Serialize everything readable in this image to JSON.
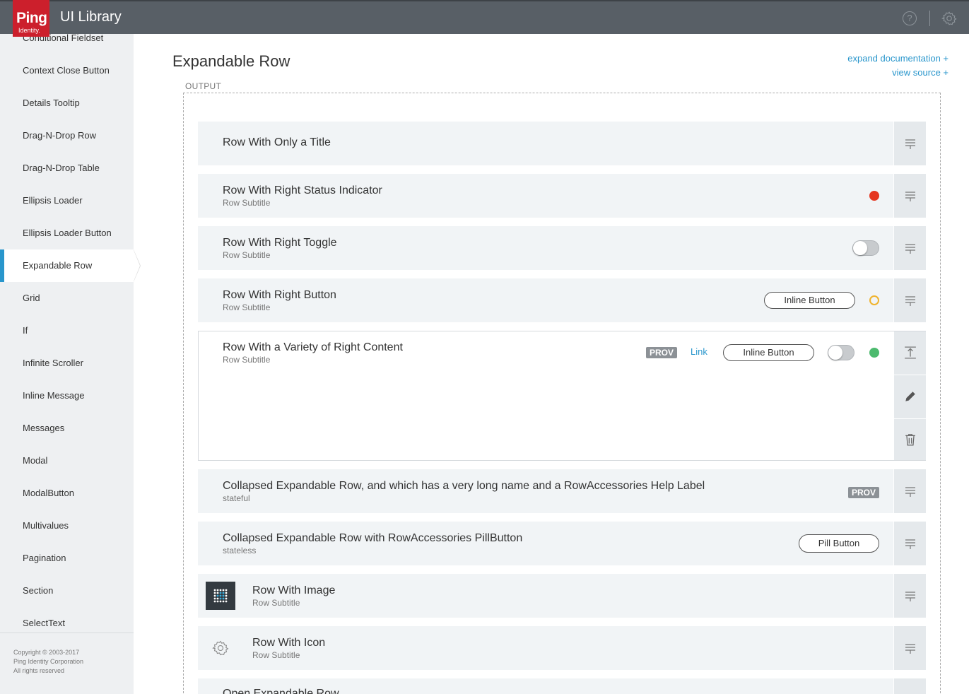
{
  "header": {
    "logo_main": "Ping",
    "logo_sub": "Identity.",
    "app_title": "UI Library",
    "help_glyph": "?",
    "icons": [
      "help-icon",
      "gear-icon"
    ]
  },
  "sidebar": {
    "items": [
      {
        "label": "Conditional Fieldset",
        "active": false
      },
      {
        "label": "Context Close Button",
        "active": false
      },
      {
        "label": "Details Tooltip",
        "active": false
      },
      {
        "label": "Drag-N-Drop Row",
        "active": false
      },
      {
        "label": "Drag-N-Drop Table",
        "active": false
      },
      {
        "label": "Ellipsis Loader",
        "active": false
      },
      {
        "label": "Ellipsis Loader Button",
        "active": false
      },
      {
        "label": "Expandable Row",
        "active": true
      },
      {
        "label": "Grid",
        "active": false
      },
      {
        "label": "If",
        "active": false
      },
      {
        "label": "Infinite Scroller",
        "active": false
      },
      {
        "label": "Inline Message",
        "active": false
      },
      {
        "label": "Messages",
        "active": false
      },
      {
        "label": "Modal",
        "active": false
      },
      {
        "label": "ModalButton",
        "active": false
      },
      {
        "label": "Multivalues",
        "active": false
      },
      {
        "label": "Pagination",
        "active": false
      },
      {
        "label": "Section",
        "active": false
      },
      {
        "label": "SelectText",
        "active": false
      }
    ],
    "footer": {
      "copyright": "Copyright © 2003-2017",
      "company": "Ping Identity Corporation",
      "rights": "All rights reserved"
    }
  },
  "main": {
    "title": "Expandable Row",
    "expand_documentation": "expand documentation +",
    "view_source": "view source +",
    "output_label": "OUTPUT",
    "rows": [
      {
        "title": "Row With Only a Title"
      },
      {
        "title": "Row With Right Status Indicator",
        "subtitle": "Row Subtitle",
        "status_color": "#e5351f"
      },
      {
        "title": "Row With Right Toggle",
        "subtitle": "Row Subtitle"
      },
      {
        "title": "Row With Right Button",
        "subtitle": "Row Subtitle",
        "button": "Inline Button",
        "status_color": "#f0b32d"
      },
      {
        "title": "Row With a Variety of Right Content",
        "subtitle": "Row Subtitle",
        "badge": "PROV",
        "link": "Link",
        "button": "Inline Button",
        "status_color": "#4cba6e",
        "expanded": true
      },
      {
        "title": "Collapsed Expandable Row, and which has a very long name and a RowAccessories Help Label",
        "subtitle": "stateful",
        "badge": "PROV"
      },
      {
        "title": "Collapsed Expandable Row with RowAccessories PillButton",
        "subtitle": "stateless",
        "button": "Pill Button"
      },
      {
        "title": "Row With Image",
        "subtitle": "Row Subtitle"
      },
      {
        "title": "Row With Icon",
        "subtitle": "Row Subtitle"
      },
      {
        "title": "Open Expandable Row"
      }
    ]
  },
  "colors": {
    "header_bg": "#585f66",
    "accent": "#2996cc",
    "brand_red": "#cc1f2c",
    "row_bg": "#f1f4f6"
  }
}
